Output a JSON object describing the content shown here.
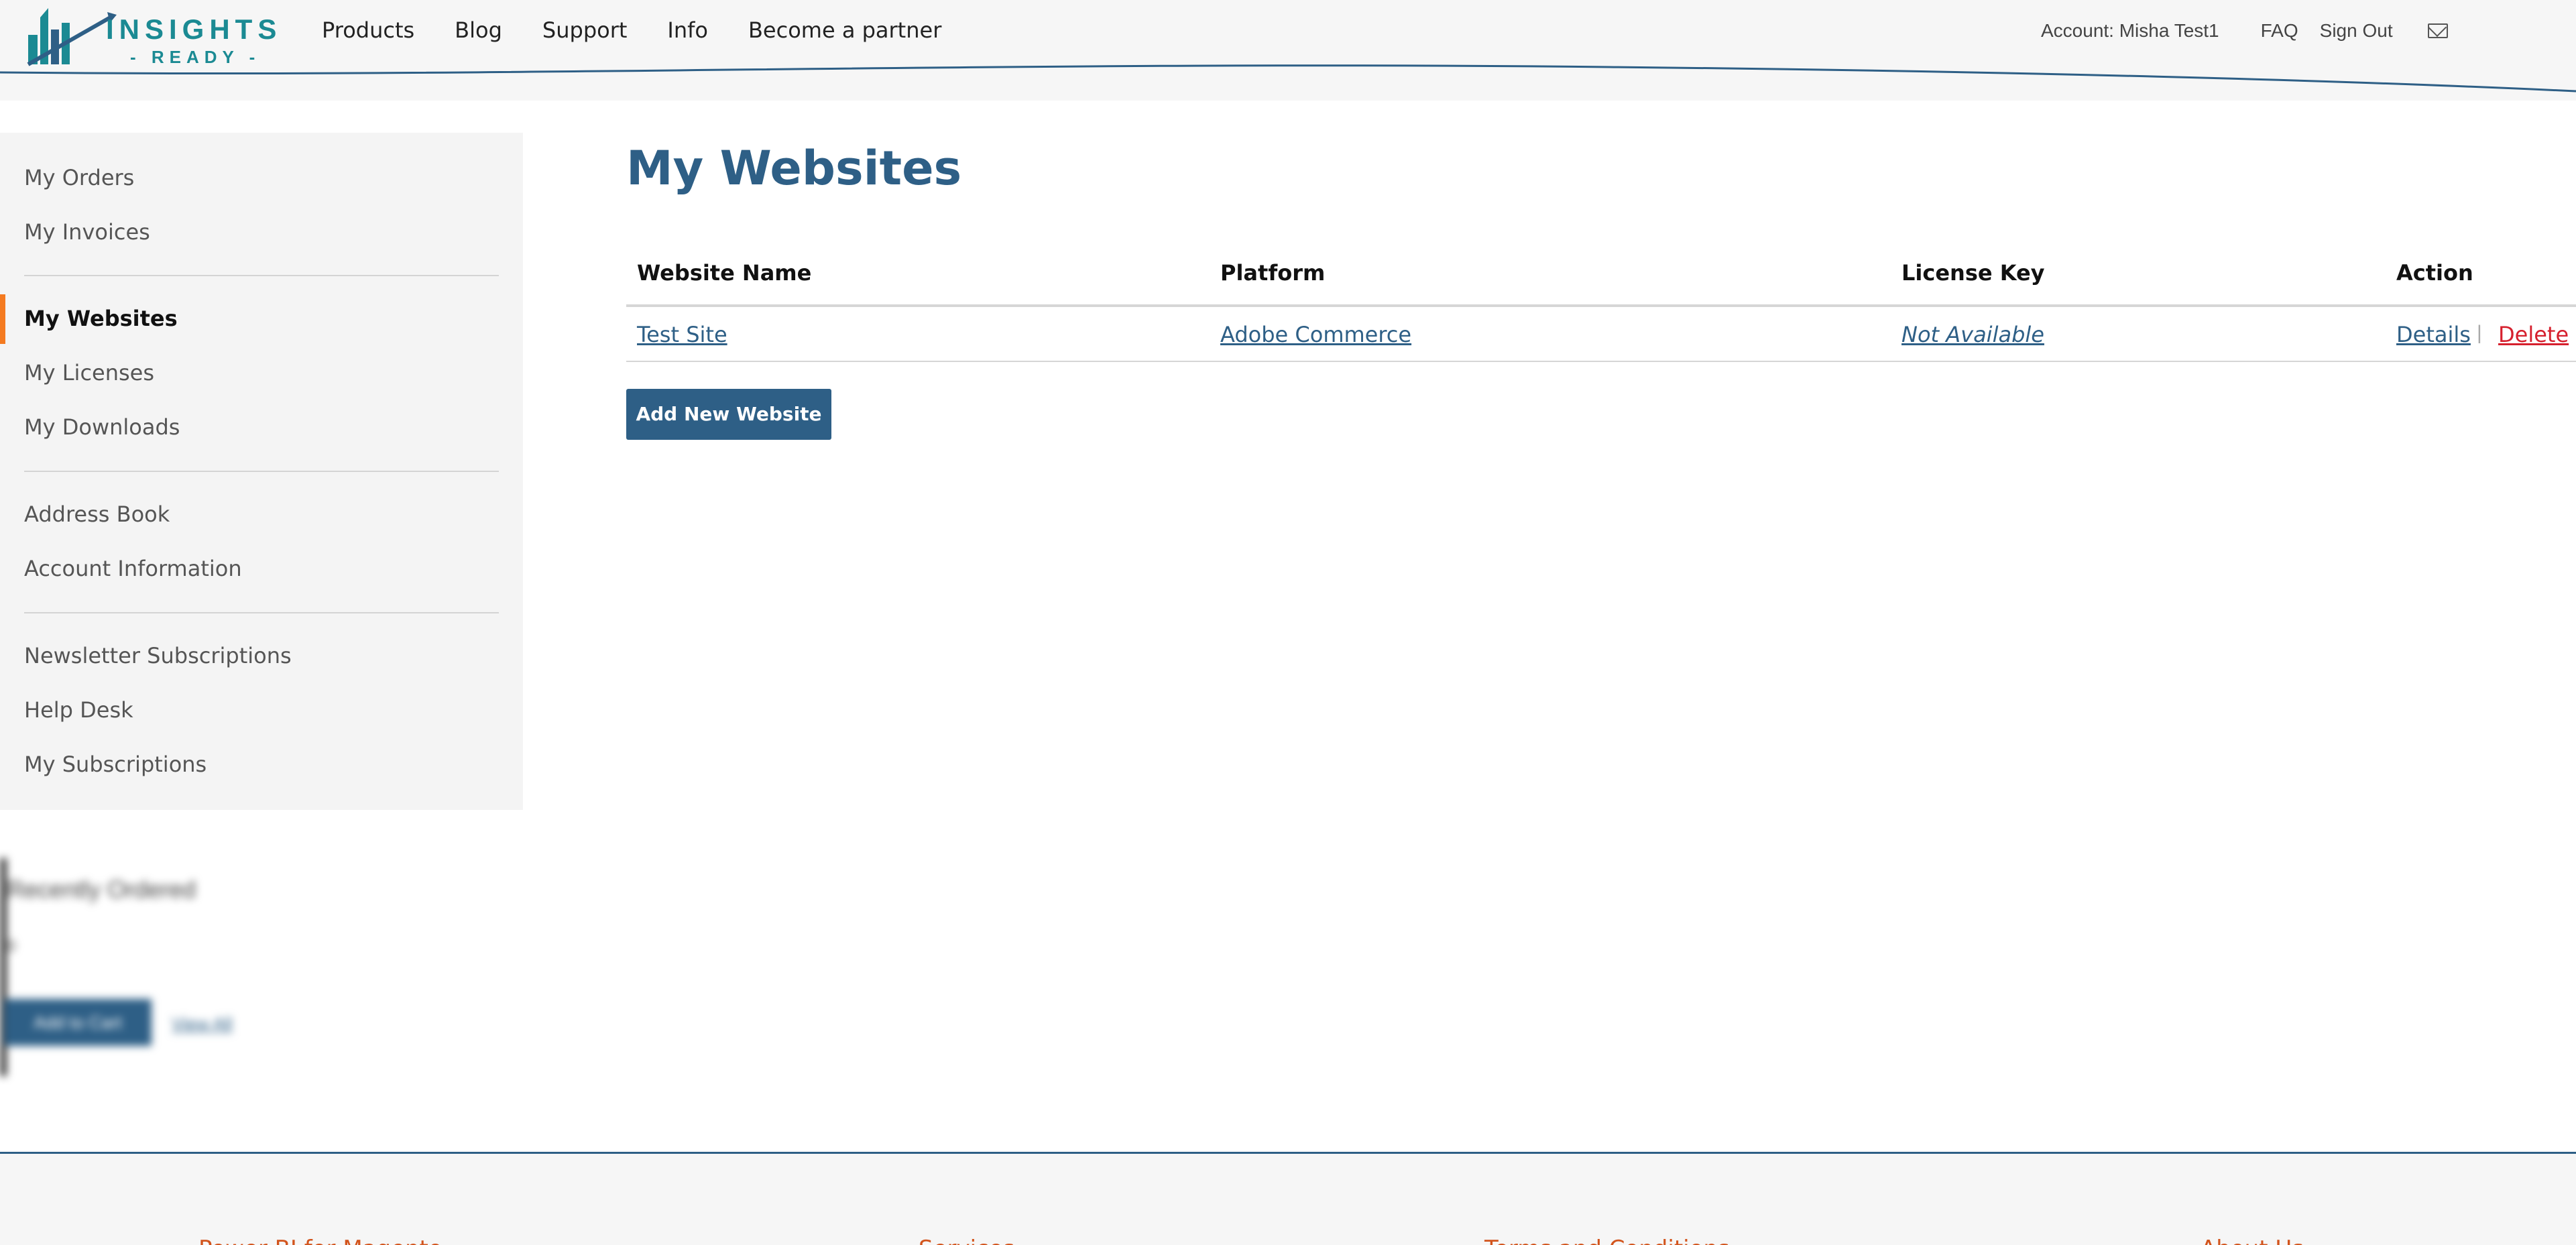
{
  "header": {
    "logo_text": "INSIGHTS",
    "logo_sub": "- READY -",
    "nav": [
      "Products",
      "Blog",
      "Support",
      "Info",
      "Become a partner"
    ],
    "account_label": "Account: Misha Test1",
    "faq": "FAQ",
    "sign_out": "Sign Out",
    "mail_icon": "mail-icon"
  },
  "sidebar": {
    "items": [
      "My Orders",
      "My Invoices",
      "My Websites",
      "My Licenses",
      "My Downloads",
      "Address Book",
      "Account Information",
      "Newsletter Subscriptions",
      "Help Desk",
      "My Subscriptions"
    ],
    "active_index": 2
  },
  "recently_ordered": {
    "title": "Recently Ordered",
    "count": "0",
    "add_to_cart": "Add to Cart",
    "view_all": "View All"
  },
  "main": {
    "title": "My Websites",
    "table": {
      "headers": [
        "Website Name",
        "Platform",
        "License Key",
        "Action"
      ],
      "rows": [
        {
          "website_name": "Test Site",
          "platform": "Adobe Commerce",
          "license_key": "Not Available",
          "details": "Details",
          "delete": "Delete"
        }
      ]
    },
    "add_button": "Add New Website"
  },
  "footer": {
    "columns": [
      "Power BI for Magento",
      "Services",
      "Terms and Conditions",
      "About Us"
    ]
  },
  "colors": {
    "brand_blue": "#2e5f86",
    "logo_teal": "#1b8a93",
    "accent_orange": "#f47a20",
    "delete_red": "#d6202e"
  }
}
